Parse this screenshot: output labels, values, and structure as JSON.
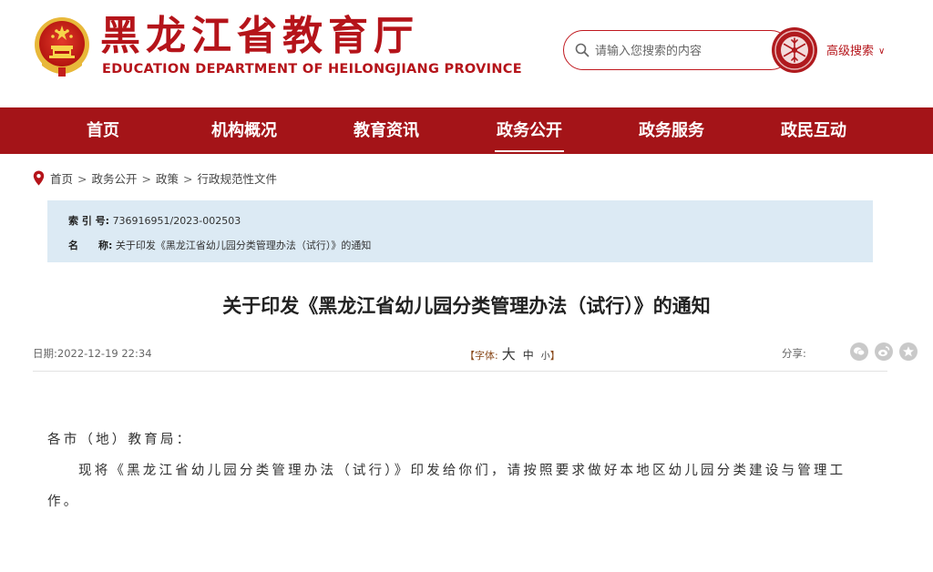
{
  "header": {
    "title_cn": "黑龙江省教育厅",
    "title_en": "EDUCATION DEPARTMENT OF HEILONGJIANG PROVINCE",
    "search_placeholder": "请输入您搜索的内容",
    "advanced_search": "高级搜索",
    "brand_color": "#b5141a"
  },
  "nav": {
    "items": [
      {
        "label": "首页"
      },
      {
        "label": "机构概况"
      },
      {
        "label": "教育资讯"
      },
      {
        "label": "政务公开"
      },
      {
        "label": "政务服务"
      },
      {
        "label": "政民互动"
      }
    ],
    "active_index": 3,
    "bg_color": "#a41418"
  },
  "breadcrumb": {
    "items": [
      "首页",
      "政务公开",
      "政策",
      "行政规范性文件"
    ],
    "separator": ">"
  },
  "info": {
    "index_label": "索 引 号:",
    "index_value": "736916951/2023-002503",
    "name_label": "名　　称:",
    "name_value": "关于印发《黑龙江省幼儿园分类管理办法（试行）》的通知",
    "bg_color": "#dceaf4"
  },
  "article": {
    "title": "关于印发《黑龙江省幼儿园分类管理办法（试行）》的通知",
    "date_label": "日期:",
    "date_value": "2022-12-19 22:34",
    "fontsize_label": "【字体:",
    "fontsize_big": "大",
    "fontsize_mid": "中",
    "fontsize_small": "小",
    "fontsize_close": "】",
    "share_label": "分享:",
    "share_icons": [
      "wechat-icon",
      "weibo-icon",
      "favorite-icon"
    ],
    "salutation": "各市（地）教育局：",
    "body": "现将《黑龙江省幼儿园分类管理办法（试行）》印发给你们，请按照要求做好本地区幼儿园分类建设与管理工作。"
  }
}
